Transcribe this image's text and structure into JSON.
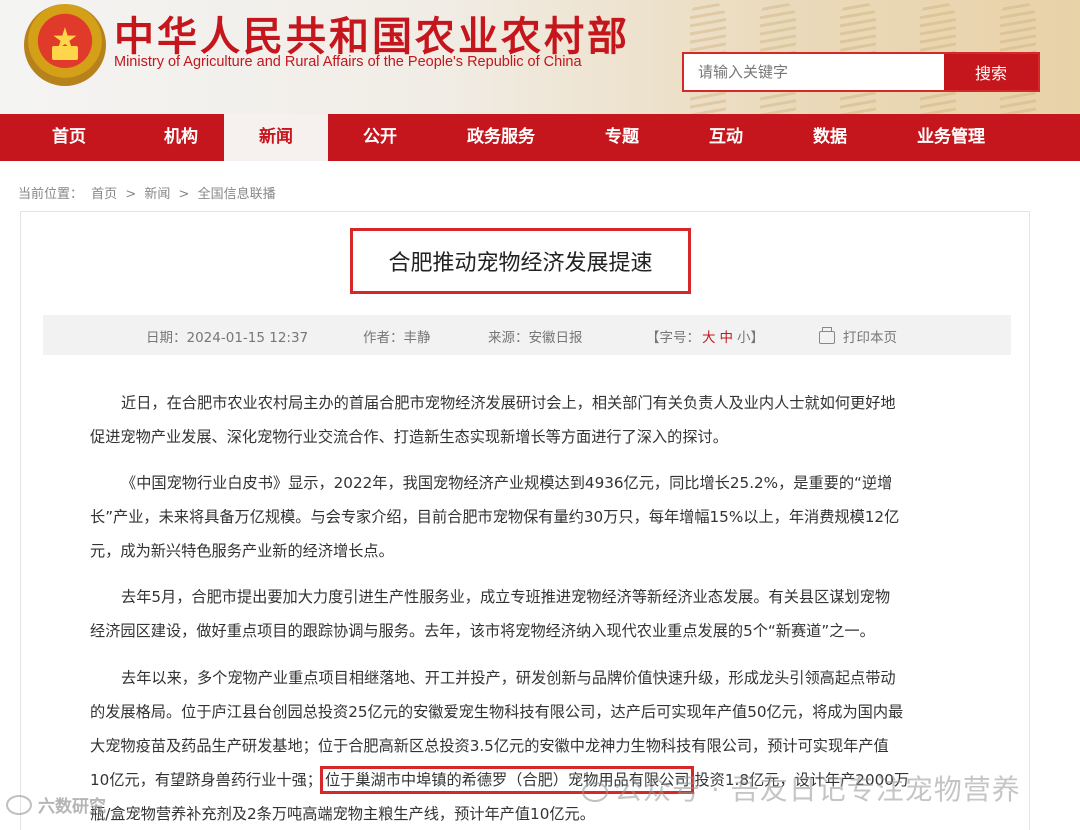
{
  "site": {
    "title_cn": "中华人民共和国农业农村部",
    "title_en": "Ministry of Agriculture and Rural Affairs of the People's Republic of China"
  },
  "search": {
    "placeholder": "请输入关键字",
    "button": "搜索"
  },
  "nav": [
    {
      "label": "首页",
      "active": false
    },
    {
      "label": "机构",
      "active": false
    },
    {
      "label": "新闻",
      "active": true
    },
    {
      "label": "公开",
      "active": false
    },
    {
      "label": "政务服务",
      "active": false
    },
    {
      "label": "专题",
      "active": false
    },
    {
      "label": "互动",
      "active": false
    },
    {
      "label": "数据",
      "active": false
    },
    {
      "label": "业务管理",
      "active": false
    }
  ],
  "breadcrumb": {
    "prefix": "当前位置：",
    "items": [
      "首页",
      ">",
      "新闻",
      ">",
      "全国信息联播"
    ]
  },
  "article": {
    "title": "合肥推动宠物经济发展提速",
    "meta": {
      "date": "日期：2024-01-15 12:37",
      "author": "作者：丰静",
      "source": "来源：安徽日报",
      "font_label": "【字号：",
      "font_large": "大",
      "font_medium": "中",
      "font_small": "小】",
      "print": "打印本页"
    },
    "paragraphs": [
      {
        "lines": [
          "近日，在合肥市农业农村局主办的首届合肥市宠物经济发展研讨会上，相关部门有关负责人及业内人士就如何更好地",
          "促进宠物产业发展、深化宠物行业交流合作、打造新生态实现新增长等方面进行了深入的探讨。"
        ]
      },
      {
        "lines": [
          "《中国宠物行业白皮书》显示，2022年，我国宠物经济产业规模达到4936亿元，同比增长25.2%，是重要的“逆增",
          "长”产业，未来将具备万亿规模。与会专家介绍，目前合肥市宠物保有量约30万只，每年增幅15%以上，年消费规模12亿",
          "元，成为新兴特色服务产业新的经济增长点。"
        ]
      },
      {
        "lines": [
          "去年5月，合肥市提出要加大力度引进生产性服务业，成立专班推进宠物经济等新经济业态发展。有关县区谋划宠物",
          "经济园区建设，做好重点项目的跟踪协调与服务。去年，该市将宠物经济纳入现代农业重点发展的5个“新赛道”之一。"
        ]
      },
      {
        "lines": [
          "去年以来，多个宠物产业重点项目相继落地、开工并投产，研发创新与品牌价值快速升级，形成龙头引领高起点带动",
          "的发展格局。位于庐江县台创园总投资25亿元的安徽爱宠生物科技有限公司，达产后可实现年产值50亿元，将成为国内最",
          "大宠物疫苗及药品生产研发基地；位于合肥高新区总投资3.5亿元的安徽中龙神力生物科技有限公司，预计可实现年产值"
        ],
        "line4_a": "10亿元，有望跻身兽药行业十强；",
        "line4_hl": "位于巢湖市中埠镇的希德罗（合肥）宠物用品有限公司",
        "line4_b": "投资1.8亿元，设计年产2000万",
        "line5": "瓶/盒宠物营养补充剂及2条万吨高端宠物主粮生产线，预计年产值10亿元。"
      }
    ]
  },
  "watermark": {
    "right": "公众号 · 吾友日记专注宠物营养",
    "left": "六数研究"
  }
}
